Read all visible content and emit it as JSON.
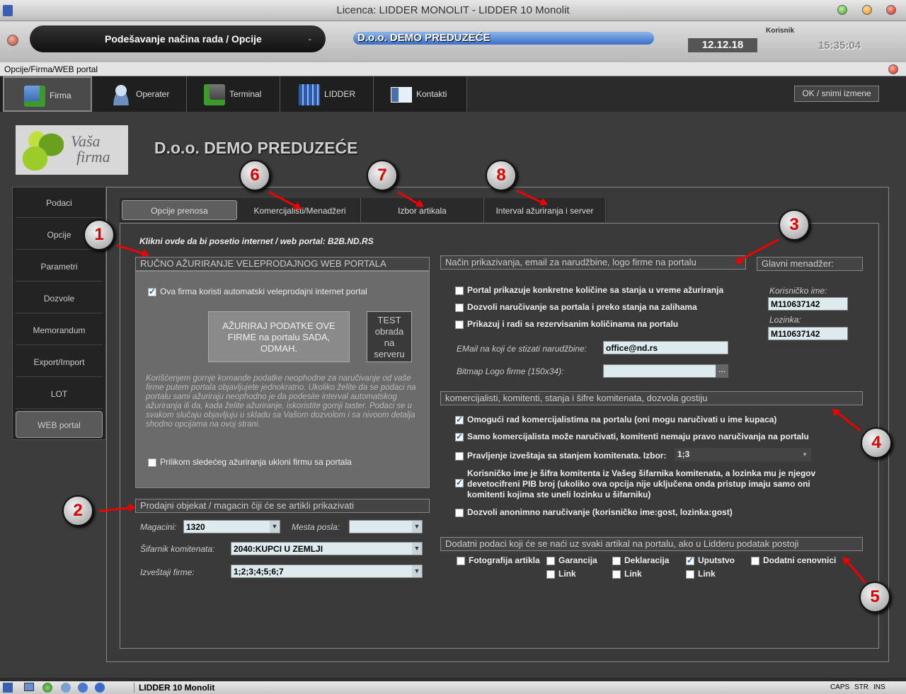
{
  "window": {
    "title": "Licenca: LIDDER MONOLIT - LIDDER 10 Monolit"
  },
  "topbar": {
    "mode": "Podešavanje načina rada / Opcije",
    "company": "D.o.o. DEMO PREDUZEĆE",
    "user_label": "Korisnik",
    "date": "12.12.18",
    "time": "15:35:04"
  },
  "subtitle": "Opcije/Firma/WEB portal",
  "main_tabs": [
    "Firma",
    "Operater",
    "Terminal",
    "LIDDER",
    "Kontakti"
  ],
  "ok_button": "OK / snimi izmene",
  "company_name": "D.o.o. DEMO PREDUZEĆE",
  "logo_text": [
    "Vaša",
    "firma"
  ],
  "sidebar": [
    "Podaci",
    "Opcije",
    "Parametri",
    "Dozvole",
    "Memorandum",
    "Export/Import",
    "LOT",
    "WEB portal"
  ],
  "sub_tabs": [
    "Opcije prenosa",
    "Komercijalisti/Menadžeri",
    "Izbor artikala",
    "Interval ažuriranja i server"
  ],
  "portal_link": "Klikni ovde da bi posetio internet / web portal: B2B.ND.RS",
  "manual": {
    "title": "RUČNO AŽURIRANJE VELEPRODAJNOG WEB PORTALA",
    "auto_cb": "Ova firma koristi automatski veleprodajni internet portal",
    "update_btn": "AŽURIRAJ PODATKE OVE FIRME na portalu SADA, ODMAH.",
    "test_btn": "TEST obrada na serveru",
    "note": "Korišćenjem gornje komande podatke neophodne za naručivanje od vaše firme putem portala objavljujete jednokratno. Ukoliko želite da se podaci na portalu sami ažuriraju neophodno je da podesite interval automatskog ažuriranja ili da, kada želite ažuriranje, iskoristite gornji taster. Podaci se u svakom slučaju objavljuju u skladu sa Vašom dozvolom i sa nivoom detalja shodno opcijama na ovoj strani.",
    "remove_cb": "Prilikom sledećeg ažuriranja ukloni firmu sa portala"
  },
  "warehouse": {
    "title": "Prodajni objekat / magacin čiji će se artikli prikazivati",
    "magacini_label": "Magacini:",
    "magacini_value": "1320",
    "mesta_label": "Mesta posla:",
    "mesta_value": "",
    "sifarnik_label": "Šifarnik komitenata:",
    "sifarnik_value": "2040:KUPCI U ZEMLJI",
    "izvestaji_label": "Izveštaji firme:",
    "izvestaji_value": "1;2;3;4;5;6;7"
  },
  "display": {
    "title": "Način prikazivanja, email za narudžbine, logo firme na portalu",
    "cb1": "Portal prikazuje konkretne količine sa stanja u vreme ažuriranja",
    "cb2": "Dozvoli naručivanje sa portala i preko stanja na zalihama",
    "cb3": "Prikazuj i radi sa rezervisanim količinama na portalu",
    "email_label": "EMail na koji će stizati narudžbine:",
    "email_value": "office@nd.rs",
    "bitmap_label": "Bitmap Logo firme (150x34):",
    "bitmap_btn": "..."
  },
  "manager": {
    "title": "Glavni menadžer:",
    "user_label": "Korisničko ime:",
    "user_value": "M110637142",
    "pass_label": "Lozinka:",
    "pass_value": "M110637142"
  },
  "comm": {
    "title": "komercijalisti, komitenti, stanja i šifre komitenata, dozvola gostiju",
    "cb1": "Omogući rad komercijalistima na portalu (oni mogu naručivati u ime kupaca)",
    "cb2": "Samo komercijalista može naručivati, komitenti nemaju pravo naručivanja na portalu",
    "cb3": "Pravljenje izveštaja sa stanjem komitenata. Izbor:",
    "cb3_value": "1;3",
    "cb4": "Korisničko ime je šifra komitenta iz Vašeg šifarnika komitenata, a lozinka mu je njegov devetocifreni PIB broj (ukoliko ova opcija nije uključena onda pristup imaju samo oni komitenti kojima ste uneli lozinku u šifarniku)",
    "cb5": "Dozvoli anonimno naručivanje (korisničko ime:gost, lozinka:gost)"
  },
  "extra": {
    "title": "Dodatni podaci koji će se naći uz svaki artikal na portalu, ako u Lidderu podatak postoji",
    "items": [
      "Fotografija artikla",
      "Garancija",
      "Deklaracija",
      "Uputstvo",
      "Dodatni cenovnici"
    ],
    "link": "Link"
  },
  "markers": [
    "1",
    "2",
    "3",
    "4",
    "5",
    "6",
    "7",
    "8"
  ],
  "taskbar": {
    "app": "LIDDER 10 Monolit",
    "caps": "CAPS",
    "str": "STR",
    "ins": "INS"
  }
}
